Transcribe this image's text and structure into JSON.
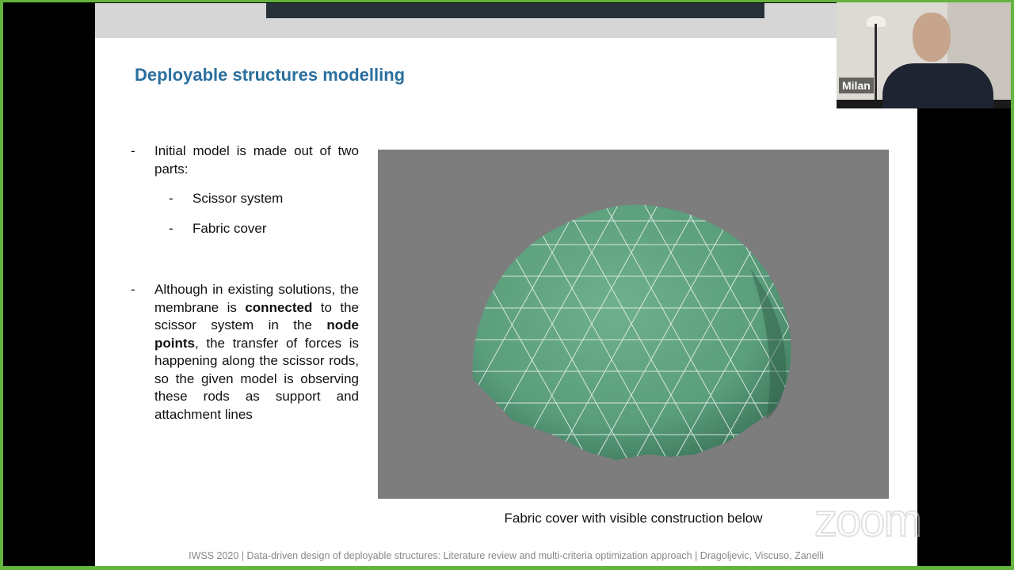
{
  "slide": {
    "title": "Deployable structures modelling",
    "bullets": {
      "b1_line1": "Initial model is made out of two",
      "b1_line2": "parts:",
      "sub1": "Scissor system",
      "sub2": "Fabric cover",
      "b2_part1": "Although in existing solutions, the membrane is ",
      "b2_bold1": "connected",
      "b2_part2": " to the scissor system in the ",
      "b2_bold2": "node points",
      "b2_part3": ", the transfer of forces is happening along the scissor rods, so the given model is observing these rods as support and attachment lines"
    },
    "dash": "-",
    "caption": "Fabric cover with visible construction below",
    "footer": "IWSS 2020 | Data-driven design of deployable structures: Literature review and multi-criteria optimization approach | Dragoljevic, Viscuso, Zanelli"
  },
  "participant": {
    "name": "Milan"
  },
  "watermark": "zoom",
  "colors": {
    "frame_border": "#63b33e",
    "title": "#2b6f9e",
    "dome_fill": "#5a9e7c",
    "image_bg": "#7d7d7d"
  }
}
